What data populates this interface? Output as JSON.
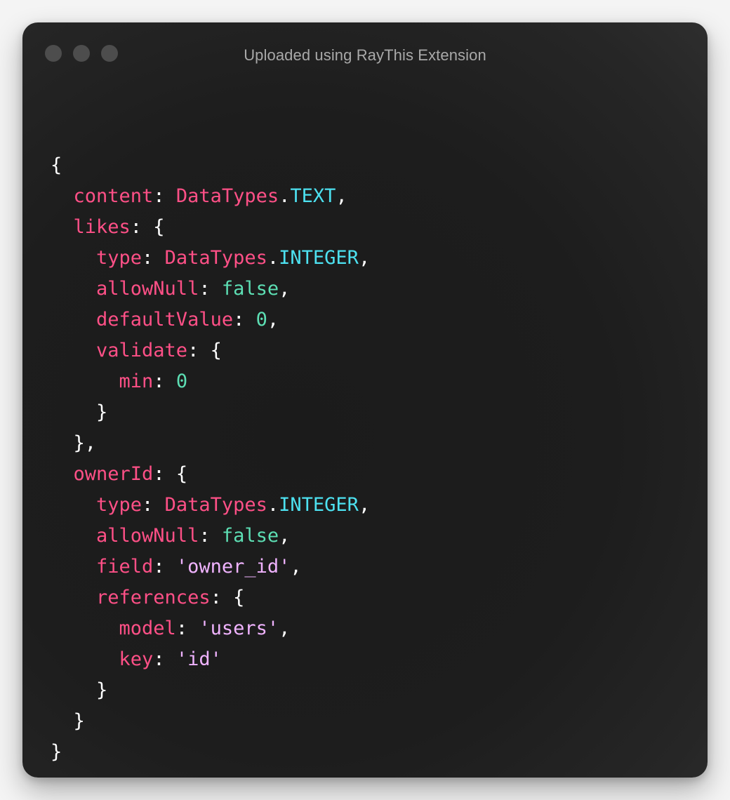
{
  "window": {
    "title": "Uploaded using RayThis Extension"
  },
  "code": {
    "lines": [
      [
        {
          "t": "p",
          "v": "{"
        }
      ],
      [
        {
          "t": "k",
          "v": "  content"
        },
        {
          "t": "p",
          "v": ": "
        },
        {
          "t": "cls",
          "v": "DataTypes"
        },
        {
          "t": "p",
          "v": "."
        },
        {
          "t": "prop",
          "v": "TEXT"
        },
        {
          "t": "p",
          "v": ","
        }
      ],
      [
        {
          "t": "k",
          "v": "  likes"
        },
        {
          "t": "p",
          "v": ": {"
        }
      ],
      [
        {
          "t": "k",
          "v": "    type"
        },
        {
          "t": "p",
          "v": ": "
        },
        {
          "t": "cls",
          "v": "DataTypes"
        },
        {
          "t": "p",
          "v": "."
        },
        {
          "t": "prop",
          "v": "INTEGER"
        },
        {
          "t": "p",
          "v": ","
        }
      ],
      [
        {
          "t": "k",
          "v": "    allowNull"
        },
        {
          "t": "p",
          "v": ": "
        },
        {
          "t": "bool",
          "v": "false"
        },
        {
          "t": "p",
          "v": ","
        }
      ],
      [
        {
          "t": "k",
          "v": "    defaultValue"
        },
        {
          "t": "p",
          "v": ": "
        },
        {
          "t": "num",
          "v": "0"
        },
        {
          "t": "p",
          "v": ","
        }
      ],
      [
        {
          "t": "k",
          "v": "    validate"
        },
        {
          "t": "p",
          "v": ": {"
        }
      ],
      [
        {
          "t": "k",
          "v": "      min"
        },
        {
          "t": "p",
          "v": ": "
        },
        {
          "t": "num",
          "v": "0"
        }
      ],
      [
        {
          "t": "p",
          "v": "    }"
        }
      ],
      [
        {
          "t": "p",
          "v": "  },"
        }
      ],
      [
        {
          "t": "k",
          "v": "  ownerId"
        },
        {
          "t": "p",
          "v": ": {"
        }
      ],
      [
        {
          "t": "k",
          "v": "    type"
        },
        {
          "t": "p",
          "v": ": "
        },
        {
          "t": "cls",
          "v": "DataTypes"
        },
        {
          "t": "p",
          "v": "."
        },
        {
          "t": "prop",
          "v": "INTEGER"
        },
        {
          "t": "p",
          "v": ","
        }
      ],
      [
        {
          "t": "k",
          "v": "    allowNull"
        },
        {
          "t": "p",
          "v": ": "
        },
        {
          "t": "bool",
          "v": "false"
        },
        {
          "t": "p",
          "v": ","
        }
      ],
      [
        {
          "t": "k",
          "v": "    field"
        },
        {
          "t": "p",
          "v": ": "
        },
        {
          "t": "str",
          "v": "'owner_id'"
        },
        {
          "t": "p",
          "v": ","
        }
      ],
      [
        {
          "t": "k",
          "v": "    references"
        },
        {
          "t": "p",
          "v": ": {"
        }
      ],
      [
        {
          "t": "k",
          "v": "      model"
        },
        {
          "t": "p",
          "v": ": "
        },
        {
          "t": "str",
          "v": "'users'"
        },
        {
          "t": "p",
          "v": ","
        }
      ],
      [
        {
          "t": "k",
          "v": "      key"
        },
        {
          "t": "p",
          "v": ": "
        },
        {
          "t": "str",
          "v": "'id'"
        }
      ],
      [
        {
          "t": "p",
          "v": "    }"
        }
      ],
      [
        {
          "t": "p",
          "v": "  }"
        }
      ],
      [
        {
          "t": "p",
          "v": "}"
        }
      ]
    ]
  },
  "colors": {
    "key": "#ff5087",
    "property": "#4de1f0",
    "literal": "#5ddfb4",
    "string": "#f0b3ff",
    "punctuation": "#ffffff",
    "window_dot": "#4d4d4d",
    "title": "#a9a9a9"
  }
}
